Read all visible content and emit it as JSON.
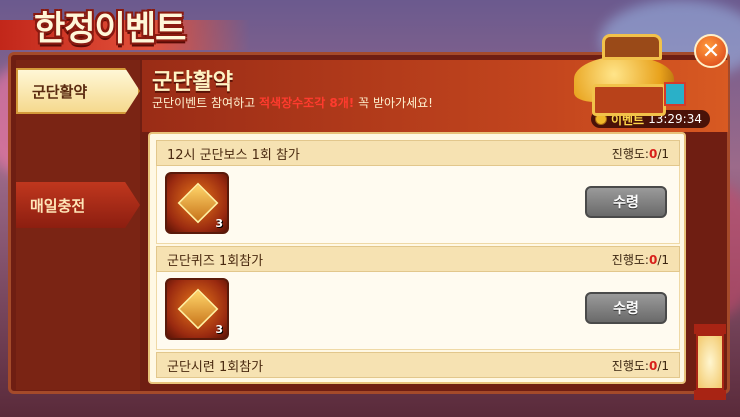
{
  "event_title": "한정이벤트",
  "sidebar": {
    "tabs": [
      {
        "label": "군단활약",
        "active": true
      },
      {
        "label": "매일충전",
        "active": false
      }
    ]
  },
  "header": {
    "title": "군단활약",
    "desc_prefix": "군단이벤트 참여하고 ",
    "desc_highlight": "적색장수조각 8개!",
    "desc_suffix": " 꼭 받아가세요!",
    "timer_label": "이벤트",
    "timer_value": "13:29:34"
  },
  "missions": [
    {
      "title": "12시 군단보스 1회 참가",
      "progress_label": "진행도:",
      "progress_current": "0",
      "progress_total": "/1",
      "reward_qty": "3",
      "claim_label": "수령"
    },
    {
      "title": "군단퀴즈 1회참가",
      "progress_label": "진행도:",
      "progress_current": "0",
      "progress_total": "/1",
      "reward_qty": "3",
      "claim_label": "수령"
    },
    {
      "title": "군단시련 1회참가",
      "progress_label": "진행도:",
      "progress_current": "0",
      "progress_total": "/1"
    }
  ],
  "colors": {
    "accent_red": "#d8201a",
    "highlight": "#ff3b2e",
    "timer_label": "#ffd84a"
  }
}
